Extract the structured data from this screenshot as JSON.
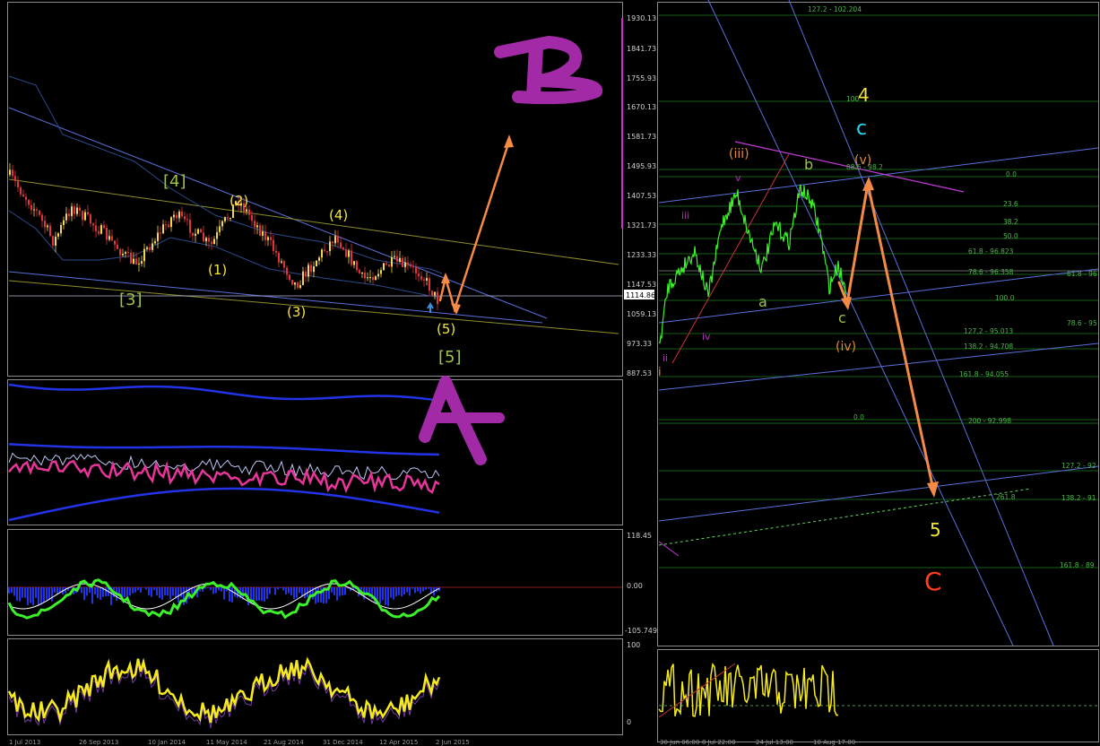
{
  "colors": {
    "background": "#000000",
    "panel_border": "#8a8a8a",
    "bull_candle": "#f2d64b",
    "bear_candle": "#e0333a",
    "price_line_green": "#3cf02a",
    "fib_line": "#1e7a1e",
    "fib_text": "#49b649",
    "trend_blue": "#5a6fd8",
    "ew_yellow": "#f5e43a",
    "ew_green": "#9ec04c",
    "ew_orange": "#f5873a",
    "ew_cyan": "#27d7f2",
    "ew_magenta": "#b02fb5",
    "ew_red": "#ff3f1a",
    "projection_arrow": "#f58a45"
  },
  "left_chart": {
    "price_axis": [
      "1930.13",
      "1841.73",
      "1755.93",
      "1670.13",
      "1581.73",
      "1495.93",
      "1407.53",
      "1321.73",
      "1233.33",
      "1147.53",
      "1059.13",
      "973.33",
      "887.53"
    ],
    "current_price": "1114.86",
    "wave_labels": {
      "w1": "(1)",
      "w2": "(2)",
      "w3": "(3)",
      "w4": "(4)",
      "w5": "(5)",
      "W3": "[3]",
      "W4": "[4]",
      "W5": "[5]"
    },
    "big_A": "A",
    "big_B": "B",
    "macd_axis": [
      "118.45",
      "0.00",
      "-105.749"
    ],
    "rsi_axis": [
      "100",
      "0"
    ],
    "date_axis": [
      "1 Jul 2013",
      "26 Sep 2013",
      "10 Jan 2014",
      "11 May 2014",
      "21 Aug 2014",
      "31 Dec 2014",
      "12 Apr 2015",
      "2 Jun 2015"
    ]
  },
  "right_chart": {
    "fib_levels": [
      "127.2 - 102.204",
      "100",
      "88.6 - 98.2",
      "0.0",
      "23.6",
      "38.2",
      "50.0",
      "61.8 - 96.823",
      "78.6 - 96.358",
      "100.0",
      "127.2 - 95.013",
      "138.2 - 94.708",
      "161.8 - 94.055",
      "0.0",
      "200 - 92.998",
      "61.8 - 96",
      "78.6 - 95",
      "127.2 - 92",
      "138.2 - 91",
      "261.8",
      "161.8 - 89"
    ],
    "wave_labels": {
      "i": "i",
      "ii": "ii",
      "iii_small": "iii",
      "iv_small": "iv",
      "v_small": "v",
      "iii": "(iii)",
      "iv": "(iv)",
      "v": "(v)",
      "a": "a",
      "b": "b",
      "c": "c",
      "c_cyan": "c",
      "four": "4",
      "five": "5",
      "C": "C"
    },
    "date_axis": [
      "30 Jun 06:00",
      "8 Jul 22:00",
      "24 Jul 13:00",
      "10 Aug 17:00"
    ]
  }
}
